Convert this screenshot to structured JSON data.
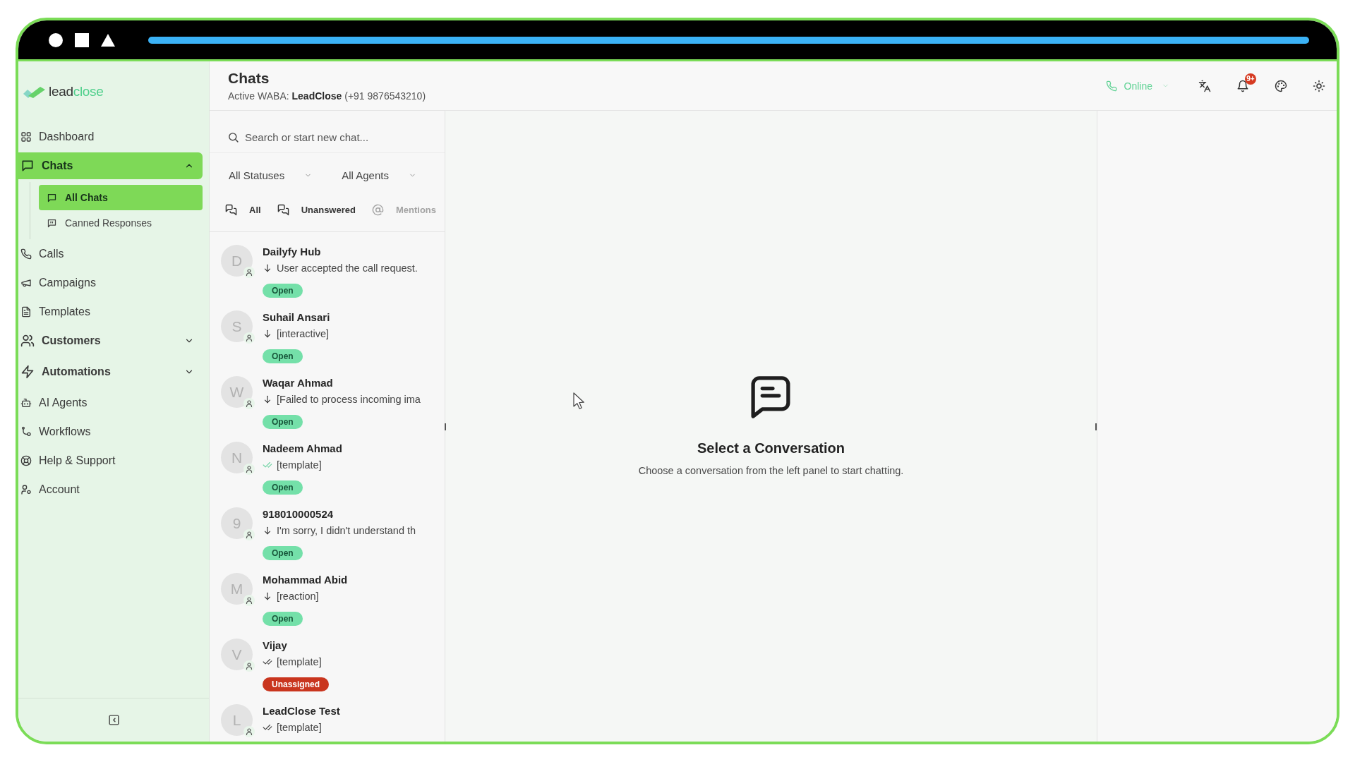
{
  "sidebar": {
    "logo": {
      "first": "lead",
      "second": "close"
    },
    "nav": [
      {
        "kind": "link",
        "label": "Dashboard",
        "selected": false
      },
      {
        "kind": "group",
        "label": "Chats",
        "selected": true,
        "expanded": true,
        "children": [
          {
            "label": "All Chats",
            "selected": true
          },
          {
            "label": "Canned Responses",
            "selected": false
          }
        ]
      },
      {
        "kind": "link",
        "label": "Calls",
        "selected": false
      },
      {
        "kind": "link",
        "label": "Campaigns",
        "selected": false
      },
      {
        "kind": "link",
        "label": "Templates",
        "selected": false
      },
      {
        "kind": "group",
        "label": "Customers",
        "selected": false,
        "expanded": false
      },
      {
        "kind": "group",
        "label": "Automations",
        "selected": false,
        "expanded": false
      },
      {
        "kind": "link",
        "label": "AI Agents",
        "selected": false
      },
      {
        "kind": "link",
        "label": "Workflows",
        "selected": false
      },
      {
        "kind": "link",
        "label": "Help & Support",
        "selected": false
      },
      {
        "kind": "link",
        "label": "Account",
        "selected": false
      }
    ]
  },
  "header": {
    "title": "Chats",
    "subtitle": "Active WABA: **LeadClose** (+91 9876543210)",
    "status": {
      "label": "Online"
    },
    "notifications": {
      "badge": "9+"
    }
  },
  "chat_list": {
    "search": {
      "placeholder": "Search or start new chat..."
    },
    "filters": [
      {
        "label": "All Statuses"
      },
      {
        "label": "All Agents"
      }
    ],
    "tabs": [
      {
        "label": "All",
        "disabled": false
      },
      {
        "label": "Unanswered",
        "disabled": false
      },
      {
        "label": "Mentions",
        "disabled": true
      }
    ],
    "chats": [
      {
        "initial": "D",
        "name": "Dailyfy Hub",
        "kind": "incoming",
        "preview": "User accepted the call request.",
        "status": {
          "label": "Open",
          "color": "#74e0a9"
        }
      },
      {
        "initial": "S",
        "name": "Suhail Ansari",
        "kind": "incoming",
        "preview": "[interactive]",
        "status": {
          "label": "Open",
          "color": "#74e0a9"
        }
      },
      {
        "initial": "W",
        "name": "Waqar Ahmad",
        "kind": "incoming",
        "preview": "[Failed to process incoming ima",
        "status": {
          "label": "Open",
          "color": "#74e0a9"
        }
      },
      {
        "initial": "N",
        "name": "Nadeem Ahmad",
        "kind": "read",
        "preview": "[template]",
        "status": {
          "label": "Open",
          "color": "#74e0a9"
        }
      },
      {
        "initial": "9",
        "name": "918010000524",
        "kind": "incoming",
        "preview": "I'm sorry, I didn't understand th",
        "status": {
          "label": "Open",
          "color": "#74e0a9"
        }
      },
      {
        "initial": "M",
        "name": "Mohammad Abid",
        "kind": "incoming",
        "preview": "[reaction]",
        "status": {
          "label": "Open",
          "color": "#74e0a9"
        }
      },
      {
        "initial": "V",
        "name": "Vijay",
        "kind": "sent",
        "preview": "[template]",
        "status": {
          "label": "Unassigned",
          "color": "#c9351e"
        }
      },
      {
        "initial": "L",
        "name": "LeadClose Test",
        "kind": "sent",
        "preview": "[template]"
      }
    ]
  },
  "conversation": {
    "empty_title": "Select a Conversation",
    "empty_text": "Choose a conversation from the left panel to start chatting."
  }
}
